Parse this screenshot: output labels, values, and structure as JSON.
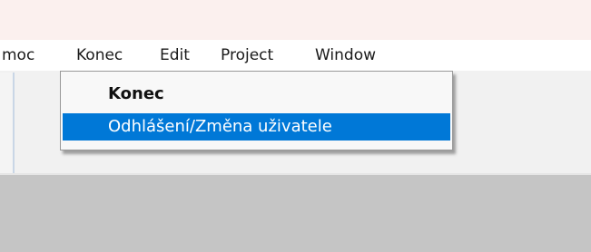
{
  "menubar": {
    "items": [
      {
        "label": "moc"
      },
      {
        "label": "Konec"
      },
      {
        "label": "Edit"
      },
      {
        "label": "Project"
      },
      {
        "label": "Window"
      }
    ]
  },
  "dropdown": {
    "items": [
      {
        "label": "Konec",
        "bold": true,
        "selected": false
      },
      {
        "label": "Odhlášení/Změna uživatele",
        "bold": false,
        "selected": true
      }
    ]
  },
  "colors": {
    "selection": "#0078d7",
    "menu_text": "#1a1a1a",
    "work_area": "#c5c5c5"
  }
}
